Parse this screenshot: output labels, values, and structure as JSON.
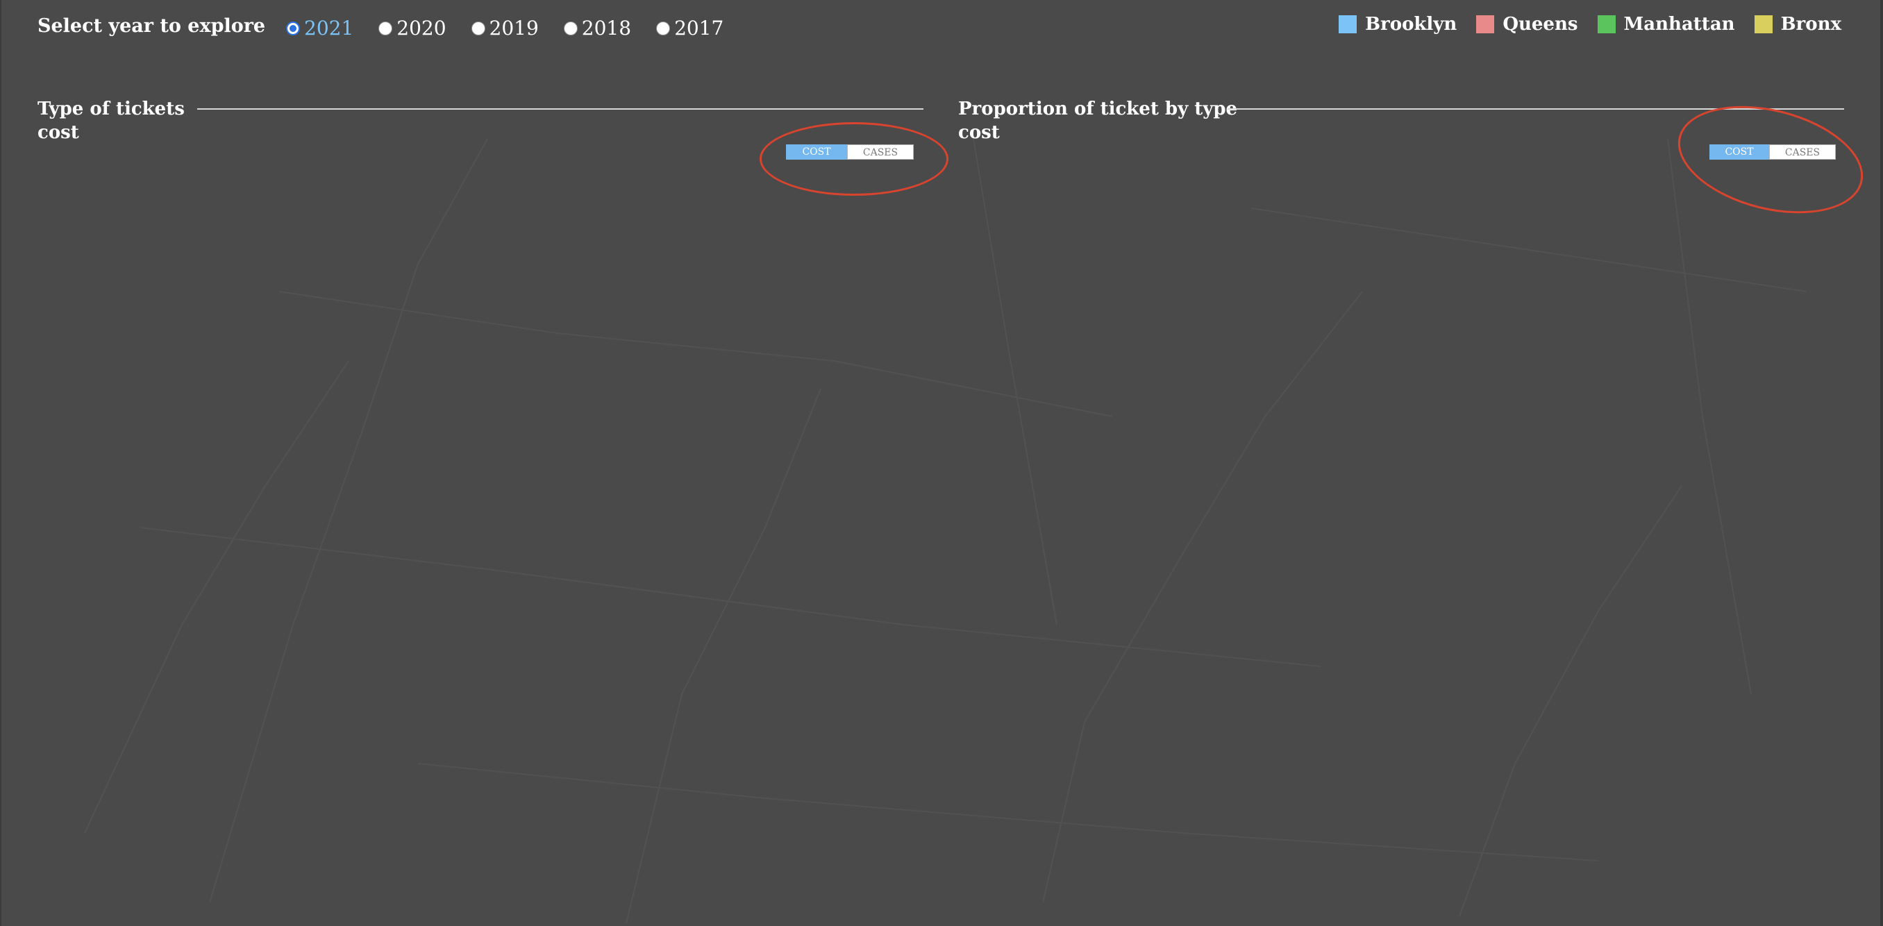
{
  "year_selector": {
    "label": "Select year to explore",
    "options": [
      {
        "label": "2021",
        "selected": true
      },
      {
        "label": "2020",
        "selected": false
      },
      {
        "label": "2019",
        "selected": false
      },
      {
        "label": "2018",
        "selected": false
      },
      {
        "label": "2017",
        "selected": false
      }
    ]
  },
  "legend": {
    "items": [
      {
        "label": "Brooklyn",
        "color": "#7cc4f6"
      },
      {
        "label": "Queens",
        "color": "#e88a8a"
      },
      {
        "label": "Manhattan",
        "color": "#5cc45c"
      },
      {
        "label": "Bronx",
        "color": "#d8cf5f"
      }
    ]
  },
  "panels": {
    "left": {
      "title_line1": "Type of tickets",
      "title_line2": "cost",
      "toggle": {
        "active": "COST",
        "inactive": "CASES"
      }
    },
    "right": {
      "title_line1": "Proportion of ticket by type",
      "title_line2": "cost",
      "toggle": {
        "active": "COST",
        "inactive": "CASES"
      }
    }
  },
  "colors": {
    "background": "#4a4a4a",
    "accent": "#7cc4f6",
    "annotation": "#d9442e"
  }
}
